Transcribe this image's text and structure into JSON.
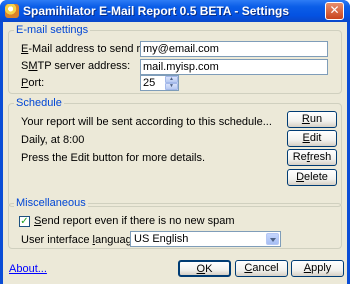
{
  "window": {
    "title": "Spamihilator E-Mail Report 0.5 BETA - Settings",
    "close_glyph": "✕"
  },
  "email_settings": {
    "group_title": "E-mail settings",
    "address_label": "E-Mail address to send report to:",
    "address_value": "my@email.com",
    "smtp_label": "SMTP server address:",
    "smtp_value": "mail.myisp.com",
    "port_label": "Port:",
    "port_value": "25"
  },
  "schedule": {
    "group_title": "Schedule",
    "info_text": "Your report will be sent according to this schedule...",
    "schedule_text": "Daily, at 8:00",
    "hint_text": "Press the Edit button for more details.",
    "run_label": "Run",
    "edit_label": "Edit",
    "refresh_label": "Refresh",
    "delete_label": "Delete"
  },
  "misc": {
    "group_title": "Miscellaneous",
    "send_checkbox_label": "Send report even if there is no new spam",
    "send_checked": true,
    "language_label": "User interface language:",
    "language_value": "US English"
  },
  "footer": {
    "about_link": "About...",
    "ok_label": "OK",
    "cancel_label": "Cancel",
    "apply_label": "Apply"
  }
}
